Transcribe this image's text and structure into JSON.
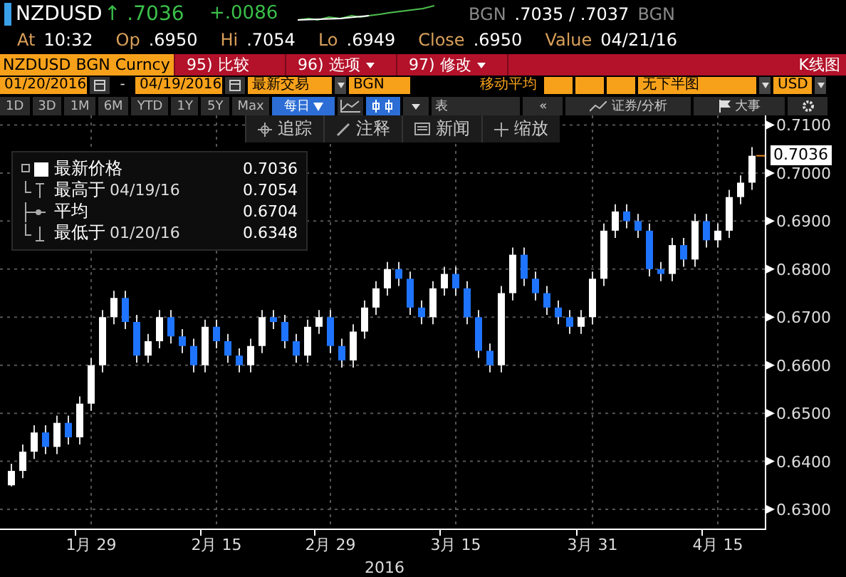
{
  "quote": {
    "ticker": "NZDUSD",
    "arrow": "↑",
    "last": ".7036",
    "change": "+.0086",
    "bid_source": "BGN",
    "bid": ".7035",
    "sep": "/",
    "ask": ".7037",
    "ask_source": "BGN"
  },
  "stats": [
    {
      "label": "At",
      "value": "10:32"
    },
    {
      "label": "Op",
      "value": ".6950"
    },
    {
      "label": "Hi",
      "value": ".7054"
    },
    {
      "label": "Lo",
      "value": ".6949"
    },
    {
      "label": "Close",
      "value": ".6950"
    },
    {
      "label": "Value",
      "value": "04/21/16"
    }
  ],
  "command_bar": {
    "security": "NZDUSD BGN Curncy",
    "title": "K线图",
    "actions": [
      {
        "code": "95)",
        "label": "比较",
        "dropdown": false
      },
      {
        "code": "96)",
        "label": "选项",
        "dropdown": true
      },
      {
        "code": "97)",
        "label": "修改",
        "dropdown": true
      }
    ]
  },
  "range": {
    "start": "01/20/2016",
    "separator": "-",
    "end": "04/19/2016",
    "price_type": "最新交易",
    "source": "BGN",
    "ma_label": "移动平均",
    "lower_chart": "无下半图",
    "currency": "USD"
  },
  "periods": [
    {
      "label": "1D",
      "selected": false
    },
    {
      "label": "3D",
      "selected": false
    },
    {
      "label": "1M",
      "selected": false
    },
    {
      "label": "6M",
      "selected": false
    },
    {
      "label": "YTD",
      "selected": false
    },
    {
      "label": "1Y",
      "selected": false
    },
    {
      "label": "5Y",
      "selected": false
    },
    {
      "label": "Max",
      "selected": false
    }
  ],
  "frequency": "每日",
  "table_label": "表",
  "back": "«",
  "analysis": "证券/分析",
  "events": "大事",
  "toolbar": [
    {
      "kind": "track",
      "label": "追踪"
    },
    {
      "kind": "note",
      "label": "注释"
    },
    {
      "kind": "news",
      "label": "新闻"
    },
    {
      "kind": "zoom",
      "label": "缩放"
    }
  ],
  "legend": [
    {
      "kind": "last",
      "label": "最新价格",
      "value": "0.7036"
    },
    {
      "kind": "high",
      "label": "最高于",
      "date": "04/19/16",
      "value": "0.7054"
    },
    {
      "kind": "avg",
      "label": "平均",
      "value": "0.6704"
    },
    {
      "kind": "low",
      "label": "最低于",
      "date": "01/20/16",
      "value": "0.6348"
    }
  ],
  "price_flag": "0.7036",
  "chart_data": {
    "type": "candlestick",
    "xlabel": "2016",
    "grid": true,
    "ylim": [
      0.626,
      0.712
    ],
    "yticks": [
      {
        "value": 0.71,
        "label": "0.7100"
      },
      {
        "value": 0.7,
        "label": "0.7000"
      },
      {
        "value": 0.69,
        "label": "0.6900"
      },
      {
        "value": 0.68,
        "label": "0.6800"
      },
      {
        "value": 0.67,
        "label": "0.6700"
      },
      {
        "value": 0.66,
        "label": "0.6600"
      },
      {
        "value": 0.65,
        "label": "0.6500"
      },
      {
        "value": 0.64,
        "label": "0.6400"
      },
      {
        "value": 0.63,
        "label": "0.6300"
      }
    ],
    "categories": [
      null,
      null,
      null,
      null,
      null,
      null,
      null,
      "1月 29",
      null,
      null,
      null,
      null,
      null,
      null,
      null,
      null,
      null,
      null,
      "2月 15",
      null,
      null,
      null,
      null,
      null,
      null,
      null,
      null,
      null,
      "2月 29",
      null,
      null,
      null,
      null,
      null,
      null,
      null,
      null,
      null,
      null,
      "3月 15",
      null,
      null,
      null,
      null,
      null,
      null,
      null,
      null,
      null,
      null,
      null,
      "3月 31",
      null,
      null,
      null,
      null,
      null,
      null,
      null,
      null,
      null,
      null,
      "4月 15",
      null,
      null,
      null
    ],
    "ohlc": [
      [
        0.635,
        0.6395,
        0.6348,
        0.638
      ],
      [
        0.638,
        0.6435,
        0.6365,
        0.642
      ],
      [
        0.642,
        0.6475,
        0.6405,
        0.646
      ],
      [
        0.646,
        0.6475,
        0.6415,
        0.643
      ],
      [
        0.643,
        0.6495,
        0.6415,
        0.648
      ],
      [
        0.648,
        0.6495,
        0.6435,
        0.645
      ],
      [
        0.645,
        0.6535,
        0.6435,
        0.652
      ],
      [
        0.652,
        0.6615,
        0.6505,
        0.66
      ],
      [
        0.66,
        0.6715,
        0.6585,
        0.67
      ],
      [
        0.67,
        0.6755,
        0.6685,
        0.674
      ],
      [
        0.674,
        0.6755,
        0.6675,
        0.669
      ],
      [
        0.669,
        0.6705,
        0.6605,
        0.662
      ],
      [
        0.662,
        0.6665,
        0.6605,
        0.665
      ],
      [
        0.665,
        0.6715,
        0.6635,
        0.67
      ],
      [
        0.67,
        0.6715,
        0.6645,
        0.666
      ],
      [
        0.666,
        0.6675,
        0.6625,
        0.664
      ],
      [
        0.664,
        0.6655,
        0.6585,
        0.66
      ],
      [
        0.66,
        0.6695,
        0.6585,
        0.668
      ],
      [
        0.668,
        0.6695,
        0.6635,
        0.665
      ],
      [
        0.665,
        0.6665,
        0.6605,
        0.662
      ],
      [
        0.662,
        0.6635,
        0.6585,
        0.66
      ],
      [
        0.66,
        0.6655,
        0.6585,
        0.664
      ],
      [
        0.664,
        0.6715,
        0.6625,
        0.67
      ],
      [
        0.67,
        0.6715,
        0.6675,
        0.669
      ],
      [
        0.669,
        0.6705,
        0.6635,
        0.665
      ],
      [
        0.665,
        0.6665,
        0.6605,
        0.662
      ],
      [
        0.662,
        0.6695,
        0.6605,
        0.668
      ],
      [
        0.668,
        0.6715,
        0.6665,
        0.67
      ],
      [
        0.67,
        0.6715,
        0.6625,
        0.664
      ],
      [
        0.664,
        0.6655,
        0.6595,
        0.661
      ],
      [
        0.661,
        0.6685,
        0.6595,
        0.667
      ],
      [
        0.667,
        0.6735,
        0.6655,
        0.672
      ],
      [
        0.672,
        0.6775,
        0.6705,
        0.676
      ],
      [
        0.676,
        0.6815,
        0.6745,
        0.68
      ],
      [
        0.68,
        0.6815,
        0.6765,
        0.678
      ],
      [
        0.678,
        0.6795,
        0.6705,
        0.672
      ],
      [
        0.672,
        0.6735,
        0.6685,
        0.67
      ],
      [
        0.67,
        0.6775,
        0.6685,
        0.676
      ],
      [
        0.676,
        0.6805,
        0.6745,
        0.679
      ],
      [
        0.679,
        0.6805,
        0.6745,
        0.676
      ],
      [
        0.676,
        0.6775,
        0.6685,
        0.67
      ],
      [
        0.67,
        0.6715,
        0.6615,
        0.663
      ],
      [
        0.663,
        0.6645,
        0.6585,
        0.66
      ],
      [
        0.66,
        0.6765,
        0.6585,
        0.675
      ],
      [
        0.675,
        0.6845,
        0.6735,
        0.683
      ],
      [
        0.683,
        0.6845,
        0.6765,
        0.678
      ],
      [
        0.678,
        0.6795,
        0.6735,
        0.675
      ],
      [
        0.675,
        0.6765,
        0.6705,
        0.672
      ],
      [
        0.672,
        0.6735,
        0.6685,
        0.67
      ],
      [
        0.67,
        0.6715,
        0.6665,
        0.668
      ],
      [
        0.668,
        0.6715,
        0.6665,
        0.67
      ],
      [
        0.67,
        0.6795,
        0.6685,
        0.678
      ],
      [
        0.678,
        0.6895,
        0.6765,
        0.688
      ],
      [
        0.688,
        0.6935,
        0.6865,
        0.692
      ],
      [
        0.692,
        0.6935,
        0.6885,
        0.69
      ],
      [
        0.69,
        0.6915,
        0.6865,
        0.688
      ],
      [
        0.688,
        0.6895,
        0.6785,
        0.68
      ],
      [
        0.68,
        0.6815,
        0.6775,
        0.679
      ],
      [
        0.679,
        0.6865,
        0.6775,
        0.685
      ],
      [
        0.685,
        0.6865,
        0.6805,
        0.682
      ],
      [
        0.682,
        0.6915,
        0.6805,
        0.69
      ],
      [
        0.69,
        0.6915,
        0.6845,
        0.686
      ],
      [
        0.686,
        0.6895,
        0.6845,
        0.688
      ],
      [
        0.688,
        0.6965,
        0.6865,
        0.695
      ],
      [
        0.695,
        0.6995,
        0.6935,
        0.698
      ],
      [
        0.698,
        0.7054,
        0.6965,
        0.7036
      ]
    ]
  }
}
